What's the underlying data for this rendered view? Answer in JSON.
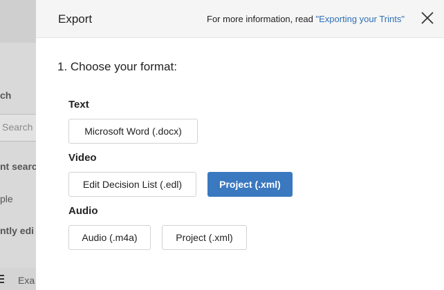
{
  "background": {
    "texts": [
      "ch",
      "Search",
      "nt searc",
      "ple",
      "ntly edi",
      "Exa"
    ]
  },
  "modal": {
    "title": "Export",
    "info_prefix": "For more information, read ",
    "info_link": "\"Exporting your Trints\"",
    "step_title": "1. Choose your format:",
    "groups": [
      {
        "label": "Text",
        "options": [
          "Microsoft Word (.docx)"
        ]
      },
      {
        "label": "Video",
        "options": [
          "Edit Decision List (.edl)",
          "Project (.xml)"
        ]
      },
      {
        "label": "Audio",
        "options": [
          "Audio (.m4a)",
          "Project (.xml)"
        ]
      }
    ],
    "selected": {
      "group": "Video",
      "option": "Project (.xml)"
    }
  },
  "colors": {
    "accent": "#3a78c0",
    "link": "#2f6fb5"
  },
  "icons": {
    "close": "close-icon",
    "list": "list-icon"
  }
}
